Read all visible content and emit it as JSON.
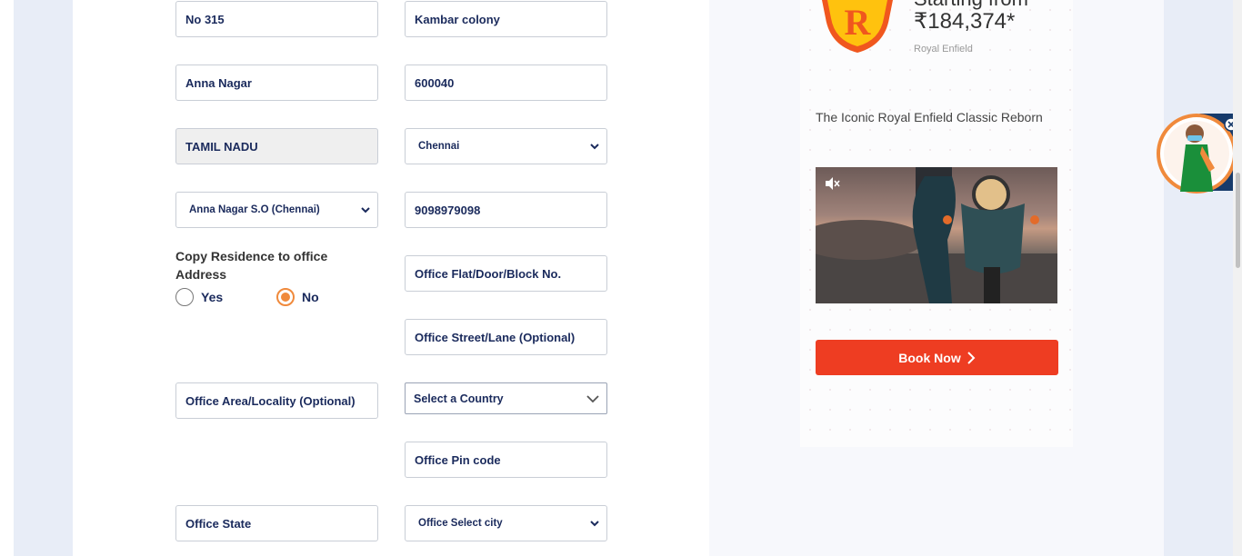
{
  "form": {
    "address_line1": "No 315",
    "address_line2": "Kambar colony",
    "area": "Anna Nagar",
    "pincode": "600040",
    "state": "TAMIL NADU",
    "city": "Chennai",
    "post_office": "Anna Nagar S.O (Chennai)",
    "phone": "9098979098",
    "copy_label": "Copy Residence to office Address",
    "copy_options": {
      "yes": "Yes",
      "no": "No",
      "selected": "No"
    },
    "office_flat_placeholder": "Office Flat/Door/Block No.",
    "office_street_placeholder": "Office Street/Lane (Optional)",
    "office_area_placeholder": "Office Area/Locality (Optional)",
    "office_country": "Select a Country",
    "office_pin_placeholder": "Office Pin code",
    "office_state_placeholder": "Office State",
    "office_city": "Office Select city"
  },
  "ad": {
    "price_top": "Starting from",
    "price": "₹184,374*",
    "brand": "Royal Enfield",
    "tagline": "The Iconic Royal Enfield Classic Reborn",
    "cta": "Book Now",
    "colors": {
      "cta": "#ee3d22",
      "logo_orange": "#f0571e",
      "logo_yellow": "#ffc20e"
    }
  },
  "colors": {
    "text_primary": "#1a2a5c",
    "radio_accent": "#f08a3c"
  }
}
